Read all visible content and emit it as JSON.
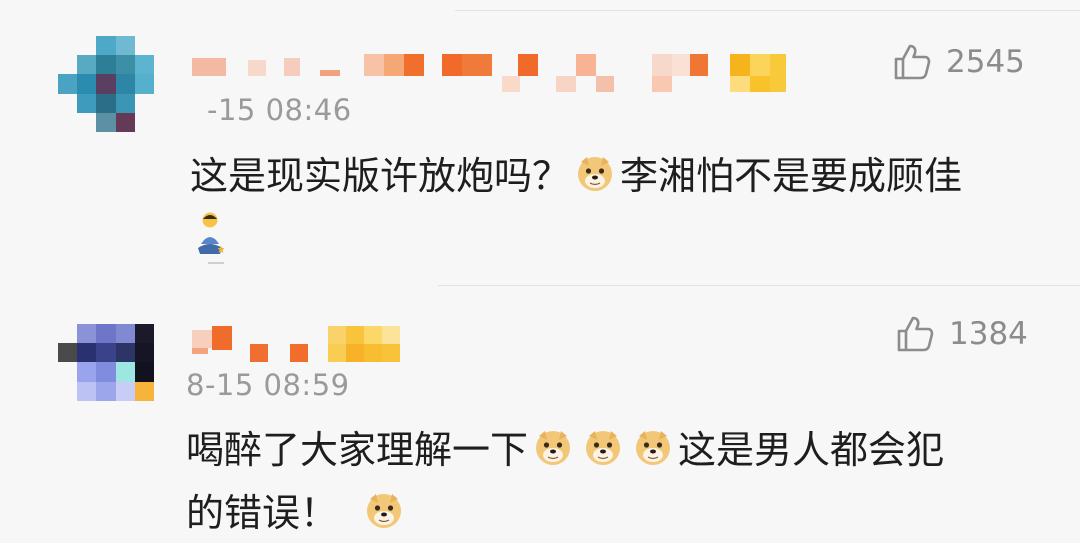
{
  "comments": [
    {
      "time": "-15 08:46",
      "likes": "2545",
      "text_line1_a": "这是现实版许放炮吗？",
      "text_line1_b": "李湘怕不是要成顾佳",
      "emoji_1": "doge-emoji",
      "sticker": "meditating-person-emoji"
    },
    {
      "time": "8-15 08:59",
      "likes": "1384",
      "text_line1_a": "喝醉了大家理解一下",
      "text_line1_b": "这是男人都会犯",
      "text_line2": "的错误！",
      "emoji_1": "doge-emoji"
    }
  ],
  "icons": {
    "like": "thumbs-up-icon"
  }
}
